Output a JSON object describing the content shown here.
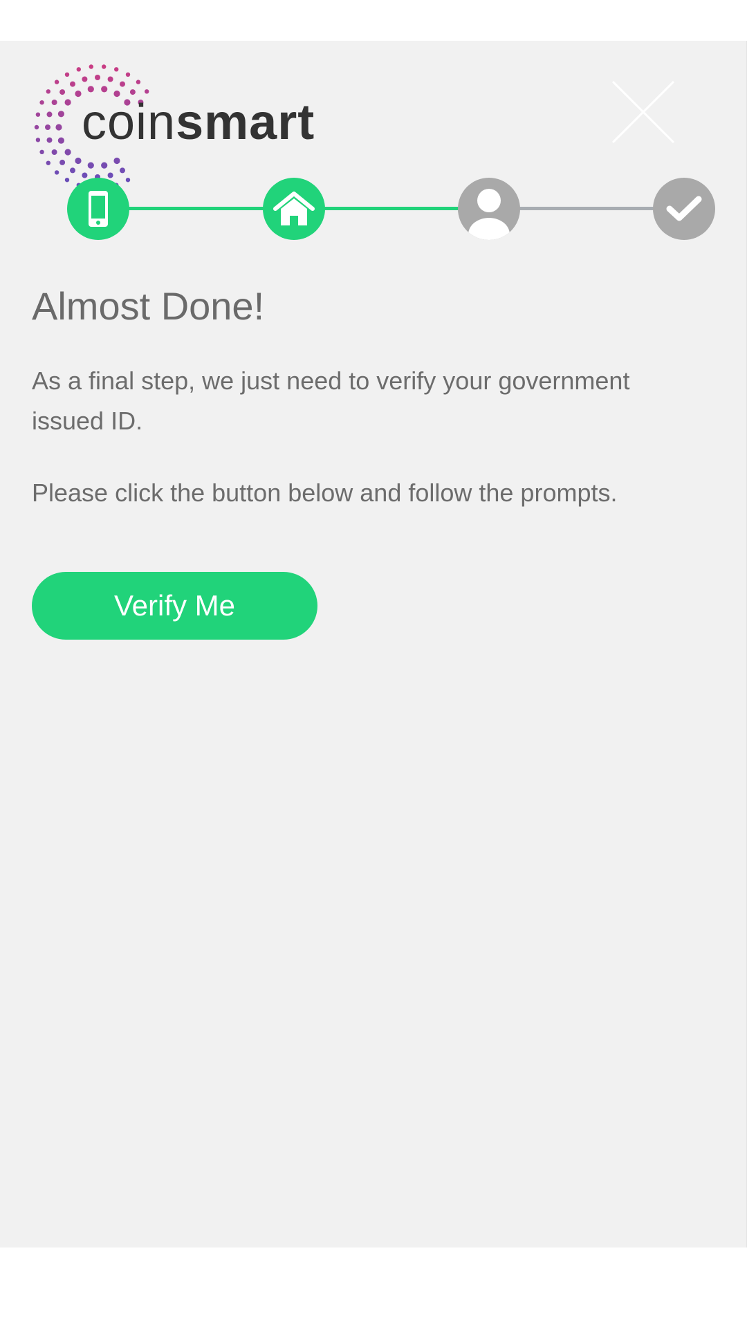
{
  "logo": {
    "text_light": "coin",
    "text_bold": "smart"
  },
  "close": {
    "icon": "close-icon"
  },
  "stepper": {
    "steps": [
      {
        "icon": "phone-icon",
        "status": "complete"
      },
      {
        "icon": "home-icon",
        "status": "complete"
      },
      {
        "icon": "user-icon",
        "status": "current"
      },
      {
        "icon": "check-icon",
        "status": "pending"
      }
    ],
    "colors": {
      "active": "#21d37a",
      "inactive": "#a9a9a9",
      "line_inactive": "#a8adb2"
    }
  },
  "content": {
    "title": "Almost Done!",
    "paragraph_1": "As a final step, we just need to verify your government issued ID.",
    "paragraph_2": "Please click the button below and follow the prompts.",
    "verify_button": "Verify Me"
  },
  "colors": {
    "accent": "#21d37a",
    "panel_bg": "#f1f1f1"
  }
}
